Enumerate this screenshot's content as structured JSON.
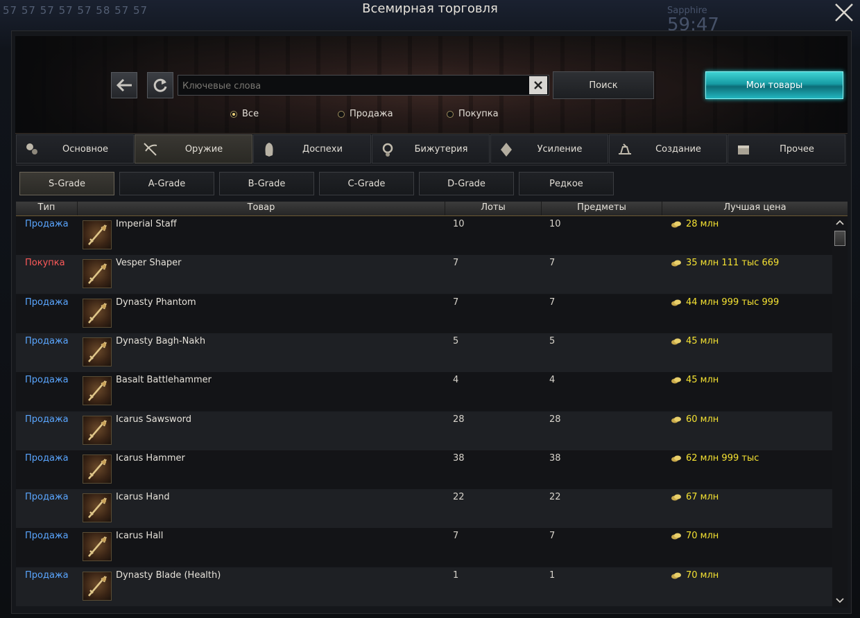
{
  "window": {
    "title": "Всемирная торговля"
  },
  "hud": {
    "levels": "57 57 57 57 57 58 57 57",
    "name": "Sapphire",
    "timer": "59:47"
  },
  "search": {
    "placeholder": "Ключевые слова",
    "value": "",
    "button_label": "Поиск"
  },
  "my_goods_label": "Мои товары",
  "filters": [
    {
      "label": "Все",
      "selected": true
    },
    {
      "label": "Продажа",
      "selected": false
    },
    {
      "label": "Покупка",
      "selected": false
    }
  ],
  "categories": [
    {
      "label": "Основное",
      "icon": "basic-icon",
      "active": false
    },
    {
      "label": "Оружие",
      "icon": "weapon-icon",
      "active": true
    },
    {
      "label": "Доспехи",
      "icon": "armor-icon",
      "active": false
    },
    {
      "label": "Бижутерия",
      "icon": "jewelry-icon",
      "active": false
    },
    {
      "label": "Усиление",
      "icon": "enhance-icon",
      "active": false
    },
    {
      "label": "Создание",
      "icon": "craft-icon",
      "active": false
    },
    {
      "label": "Прочее",
      "icon": "misc-icon",
      "active": false
    }
  ],
  "grades": [
    {
      "label": "S-Grade",
      "active": true
    },
    {
      "label": "A-Grade",
      "active": false
    },
    {
      "label": "B-Grade",
      "active": false
    },
    {
      "label": "C-Grade",
      "active": false
    },
    {
      "label": "D-Grade",
      "active": false
    },
    {
      "label": "Редкое",
      "active": false
    }
  ],
  "table": {
    "columns": [
      "Тип",
      "Товар",
      "Лоты",
      "Предметы",
      "Лучшая цена"
    ],
    "rows": [
      {
        "type": "Продажа",
        "kind": "sell",
        "name": "Imperial Staff",
        "icon": "staff-icon",
        "lots": "10",
        "items": "10",
        "price": "28 млн"
      },
      {
        "type": "Покупка",
        "kind": "buy",
        "name": "Vesper Shaper",
        "icon": "spear-icon",
        "lots": "7",
        "items": "7",
        "price": "35 млн 111 тыс 669"
      },
      {
        "type": "Продажа",
        "kind": "sell",
        "name": "Dynasty Phantom",
        "icon": "sword-icon",
        "lots": "7",
        "items": "7",
        "price": "44 млн 999 тыс 999"
      },
      {
        "type": "Продажа",
        "kind": "sell",
        "name": "Dynasty Bagh-Nakh",
        "icon": "fist-icon",
        "lots": "5",
        "items": "5",
        "price": "45 млн"
      },
      {
        "type": "Продажа",
        "kind": "sell",
        "name": "Basalt Battlehammer",
        "icon": "hammer-icon",
        "lots": "4",
        "items": "4",
        "price": "45 млн"
      },
      {
        "type": "Продажа",
        "kind": "sell",
        "name": "Icarus Sawsword",
        "icon": "sword-icon",
        "lots": "28",
        "items": "28",
        "price": "60 млн"
      },
      {
        "type": "Продажа",
        "kind": "sell",
        "name": "Icarus Hammer",
        "icon": "hammer-icon",
        "lots": "38",
        "items": "38",
        "price": "62 млн 999 тыс"
      },
      {
        "type": "Продажа",
        "kind": "sell",
        "name": "Icarus Hand",
        "icon": "fist-icon",
        "lots": "22",
        "items": "22",
        "price": "67 млн"
      },
      {
        "type": "Продажа",
        "kind": "sell",
        "name": "Icarus Hall",
        "icon": "dual-sword-icon",
        "lots": "7",
        "items": "7",
        "price": "70 млн"
      },
      {
        "type": "Продажа",
        "kind": "sell",
        "name": "Dynasty Blade (Health)",
        "icon": "dual-sword-icon",
        "lots": "1",
        "items": "1",
        "price": "70 млн"
      }
    ]
  },
  "colors": {
    "sell": "#5aa6ff",
    "buy": "#ff5a5a",
    "price": "#f5e232",
    "accent": "#1fc4cc"
  }
}
